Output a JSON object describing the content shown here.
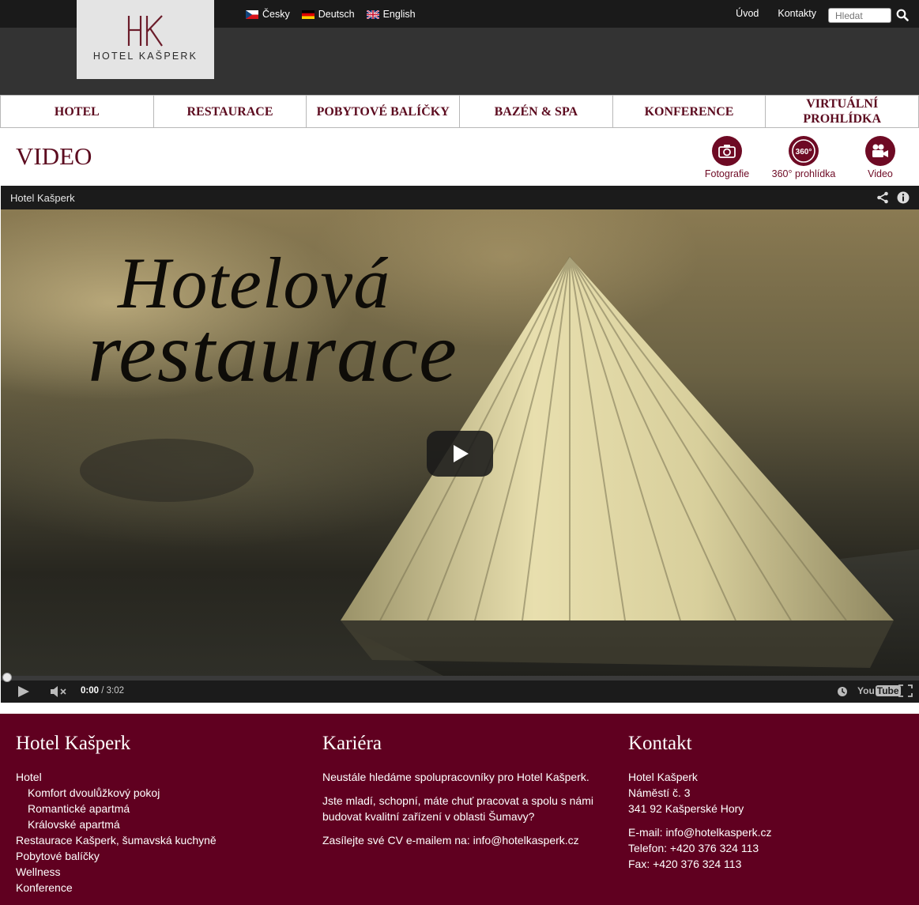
{
  "brand": {
    "name": "HOTEL KAŠPERK",
    "mark": "HK"
  },
  "languages": [
    {
      "label": "Česky",
      "flag": "flag-cz-icon"
    },
    {
      "label": "Deutsch",
      "flag": "flag-de-icon"
    },
    {
      "label": "English",
      "flag": "flag-gb-icon"
    }
  ],
  "toplinks": {
    "home": "Úvod",
    "contacts": "Kontakty"
  },
  "search": {
    "placeholder": "Hledat"
  },
  "nav": [
    "HOTEL",
    "RESTAURACE",
    "POBYTOVÉ BALÍČKY",
    "BAZÉN & SPA",
    "KONFERENCE",
    "VIRTUÁLNÍ PROHLÍDKA"
  ],
  "page": {
    "title": "VIDEO"
  },
  "media_links": {
    "photos": "Fotografie",
    "tour": "360° prohlídka",
    "tour_badge": "360°",
    "video": "Video"
  },
  "video": {
    "title": "Hotel Kašperk",
    "overlay_line1": "Hotelová",
    "overlay_line2": "restaurace",
    "current_time": "0:00",
    "duration": "/ 3:02",
    "progress": 0,
    "brand_label": "You",
    "brand_box": "Tube"
  },
  "footer": {
    "col1": {
      "heading": "Hotel Kašperk",
      "items": [
        {
          "label": "Hotel",
          "sub": false
        },
        {
          "label": "Komfort dvoulůžkový pokoj",
          "sub": true
        },
        {
          "label": "Romantické apartmá",
          "sub": true
        },
        {
          "label": "Královské apartmá",
          "sub": true
        },
        {
          "label": "Restaurace Kašperk, šumavská kuchyně",
          "sub": false
        },
        {
          "label": "Pobytové balíčky",
          "sub": false
        },
        {
          "label": "Wellness",
          "sub": false
        },
        {
          "label": "Konference",
          "sub": false
        }
      ]
    },
    "col2": {
      "heading": "Kariéra",
      "p1": "Neustále hledáme spolupracovníky pro Hotel Kašperk.",
      "p2": "Jste mladí, schopní, máte chuť pracovat a spolu s námi budovat kvalitní zařízení v oblasti Šumavy?",
      "p3": "Zasílejte své CV e-mailem na: info@hotelkasperk.cz"
    },
    "col3": {
      "heading": "Kontakt",
      "address": [
        "Hotel Kašperk",
        "Náměstí č. 3",
        "341 92 Kašperské Hory"
      ],
      "contacts": [
        "E-mail: info@hotelkasperk.cz",
        "Telefon: +420 376 324 113",
        "Fax: +420 376 324 113"
      ]
    }
  },
  "colors": {
    "brand": "#600020",
    "nav_text": "#5c0b1f",
    "topbar": "#1a1a1a",
    "header": "#333333"
  }
}
